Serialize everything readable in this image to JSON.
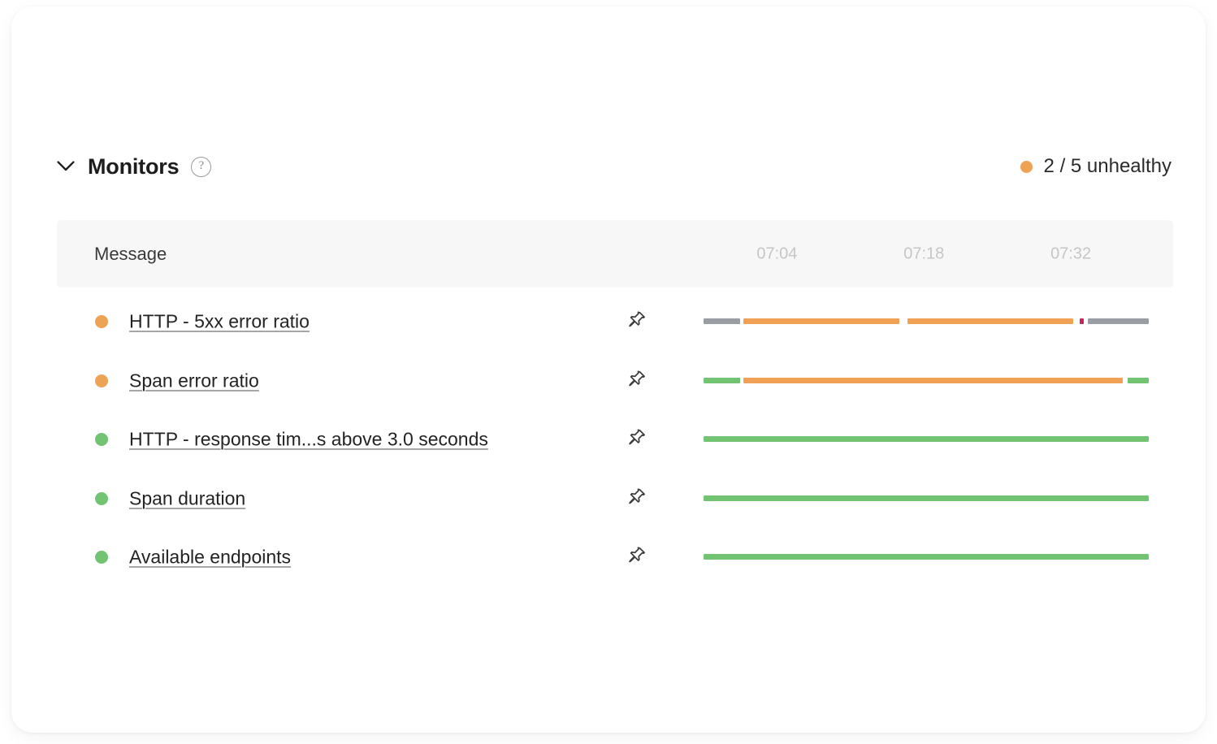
{
  "section": {
    "title": "Monitors",
    "chevron_icon": "chevron-down-icon",
    "help_icon": "help-circle-icon",
    "help_label": "?",
    "status": {
      "text": "2 / 5 unhealthy",
      "unhealthy_count": 2,
      "total_count": 5,
      "dot_color": "#eda254"
    }
  },
  "table": {
    "columns": [
      "Message"
    ],
    "message_header": "Message",
    "time_ticks": [
      {
        "label": "07:04",
        "left_pct": 16.5
      },
      {
        "label": "07:18",
        "left_pct": 49.5
      },
      {
        "label": "07:32",
        "left_pct": 82.5
      }
    ],
    "pin_icon": "pin-icon",
    "rows": [
      {
        "label": "HTTP - 5xx error ratio",
        "status": "unhealthy",
        "dot_color": "#eda254",
        "segments": [
          {
            "start_pct": 0.0,
            "width_pct": 8.2,
            "color": "#9a9da3"
          },
          {
            "start_pct": 9.0,
            "width_pct": 35.0,
            "color": "#f0a155"
          },
          {
            "start_pct": 45.8,
            "width_pct": 37.2,
            "color": "#f0a155"
          },
          {
            "start_pct": 84.5,
            "width_pct": 0.9,
            "color": "#c8265b"
          },
          {
            "start_pct": 86.4,
            "width_pct": 13.6,
            "color": "#9a9da3"
          }
        ]
      },
      {
        "label": "Span error ratio",
        "status": "unhealthy",
        "dot_color": "#eda254",
        "segments": [
          {
            "start_pct": 0.0,
            "width_pct": 8.2,
            "color": "#72c472"
          },
          {
            "start_pct": 9.0,
            "width_pct": 85.2,
            "color": "#f0a155"
          },
          {
            "start_pct": 95.2,
            "width_pct": 4.8,
            "color": "#72c472"
          }
        ]
      },
      {
        "label": "HTTP - response tim...s above 3.0 seconds",
        "status": "healthy",
        "dot_color": "#72c472",
        "segments": [
          {
            "start_pct": 0.0,
            "width_pct": 100.0,
            "color": "#72c472"
          }
        ]
      },
      {
        "label": "Span duration",
        "status": "healthy",
        "dot_color": "#72c472",
        "segments": [
          {
            "start_pct": 0.0,
            "width_pct": 100.0,
            "color": "#72c472"
          }
        ]
      },
      {
        "label": "Available endpoints",
        "status": "healthy",
        "dot_color": "#72c472",
        "segments": [
          {
            "start_pct": 0.0,
            "width_pct": 100.0,
            "color": "#72c472"
          }
        ]
      }
    ]
  }
}
